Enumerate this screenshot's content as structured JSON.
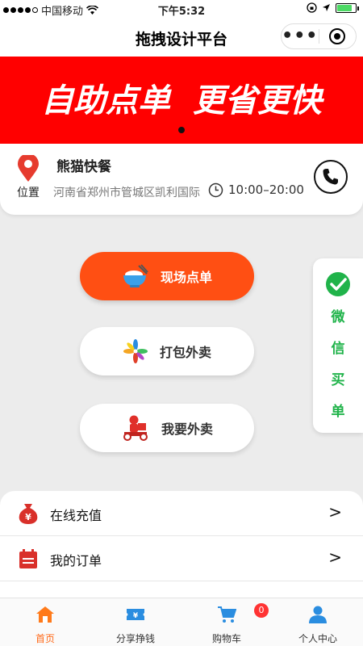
{
  "status_bar": {
    "carrier": "中国移动",
    "time": "下午5:32"
  },
  "nav": {
    "title": "拖拽设计平台"
  },
  "banner": {
    "text": "自助点单  更省更快"
  },
  "store": {
    "name": "熊猫快餐",
    "location_label": "位置",
    "address": "河南省郑州市管城区凯利国际",
    "hours": "10:00–20:00"
  },
  "actions": {
    "dine_in": "现场点单",
    "takeaway_pack": "打包外卖",
    "delivery": "我要外卖"
  },
  "wechat_pay": {
    "chars": [
      "微",
      "信",
      "买",
      "单"
    ]
  },
  "menu": {
    "items": [
      {
        "label": "在线充值",
        "arrow": ">"
      },
      {
        "label": "我的订单",
        "arrow": ">"
      }
    ]
  },
  "tabbar": {
    "tabs": [
      {
        "label": "首页",
        "icon": "home-icon"
      },
      {
        "label": "分享挣钱",
        "icon": "ticket-icon"
      },
      {
        "label": "购物车",
        "icon": "cart-icon"
      },
      {
        "label": "个人中心",
        "icon": "user-icon"
      }
    ],
    "cart_badge": "0"
  },
  "colors": {
    "accent": "#ff4f13",
    "banner": "#ff0000",
    "wechat_green": "#20b34a",
    "tab_active": "#ff6b1a"
  }
}
